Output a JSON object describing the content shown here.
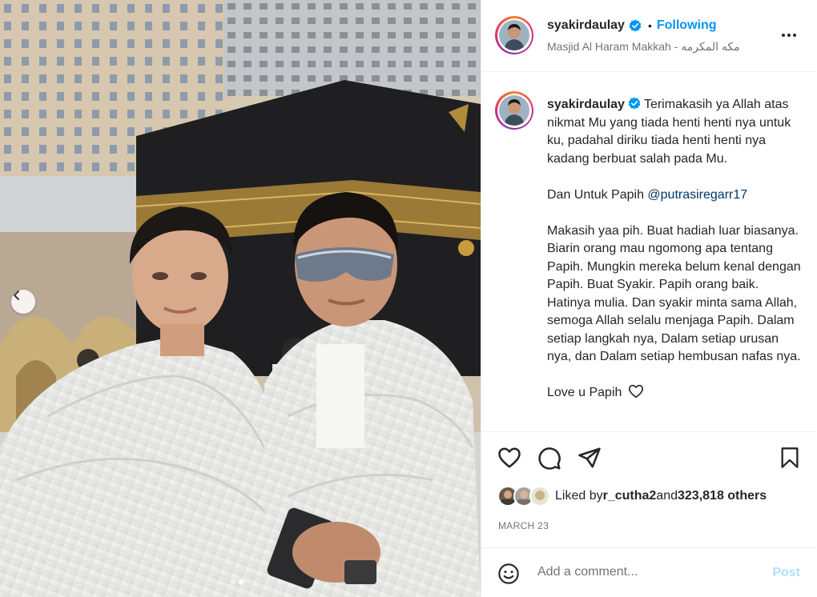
{
  "post": {
    "username": "syakirdaulay",
    "verified": true,
    "follow_status": "Following",
    "bullet": "•",
    "location": "Masjid Al Haram Makkah - مكه المكرمه"
  },
  "caption": {
    "username": "syakirdaulay",
    "line1": "Terimakasih ya Allah atas nikmat Mu yang tiada henti henti nya untuk ku, padahal diriku tiada henti henti nya kadang berbuat salah pada Mu.",
    "line2_prefix": "Dan Untuk Papih ",
    "mention": "@putrasiregarr17",
    "line3": "Makasih yaa pih. Buat hadiah luar biasanya. Biarin orang mau ngomong apa tentang Papih. Mungkin mereka belum kenal dengan Papih. Buat Syakir. Papih orang baik. Hatinya mulia. Dan syakir minta sama Allah, semoga Allah selalu menjaga Papih. Dalam setiap langkah nya, Dalam setiap urusan nya, dan Dalam setiap hembusan nafas nya.",
    "line4": "Love u Papih"
  },
  "likes": {
    "prefix": "Liked by ",
    "user": "r_cutha2",
    "middle": " and ",
    "count": "323,818 others"
  },
  "date": "MARCH 23",
  "comment_box": {
    "placeholder": "Add a comment...",
    "post_label": "Post"
  },
  "carousel": {
    "total": 2,
    "active_index": 2
  },
  "colors": {
    "accent": "#0095f6",
    "verified": "#0095f6",
    "mention": "#00376b",
    "post_disabled": "#b2dffc"
  },
  "icons": [
    "chevron-left-icon",
    "more-icon",
    "verified-badge-icon",
    "heart-icon",
    "comment-icon",
    "share-icon",
    "bookmark-icon",
    "emoji-icon"
  ]
}
